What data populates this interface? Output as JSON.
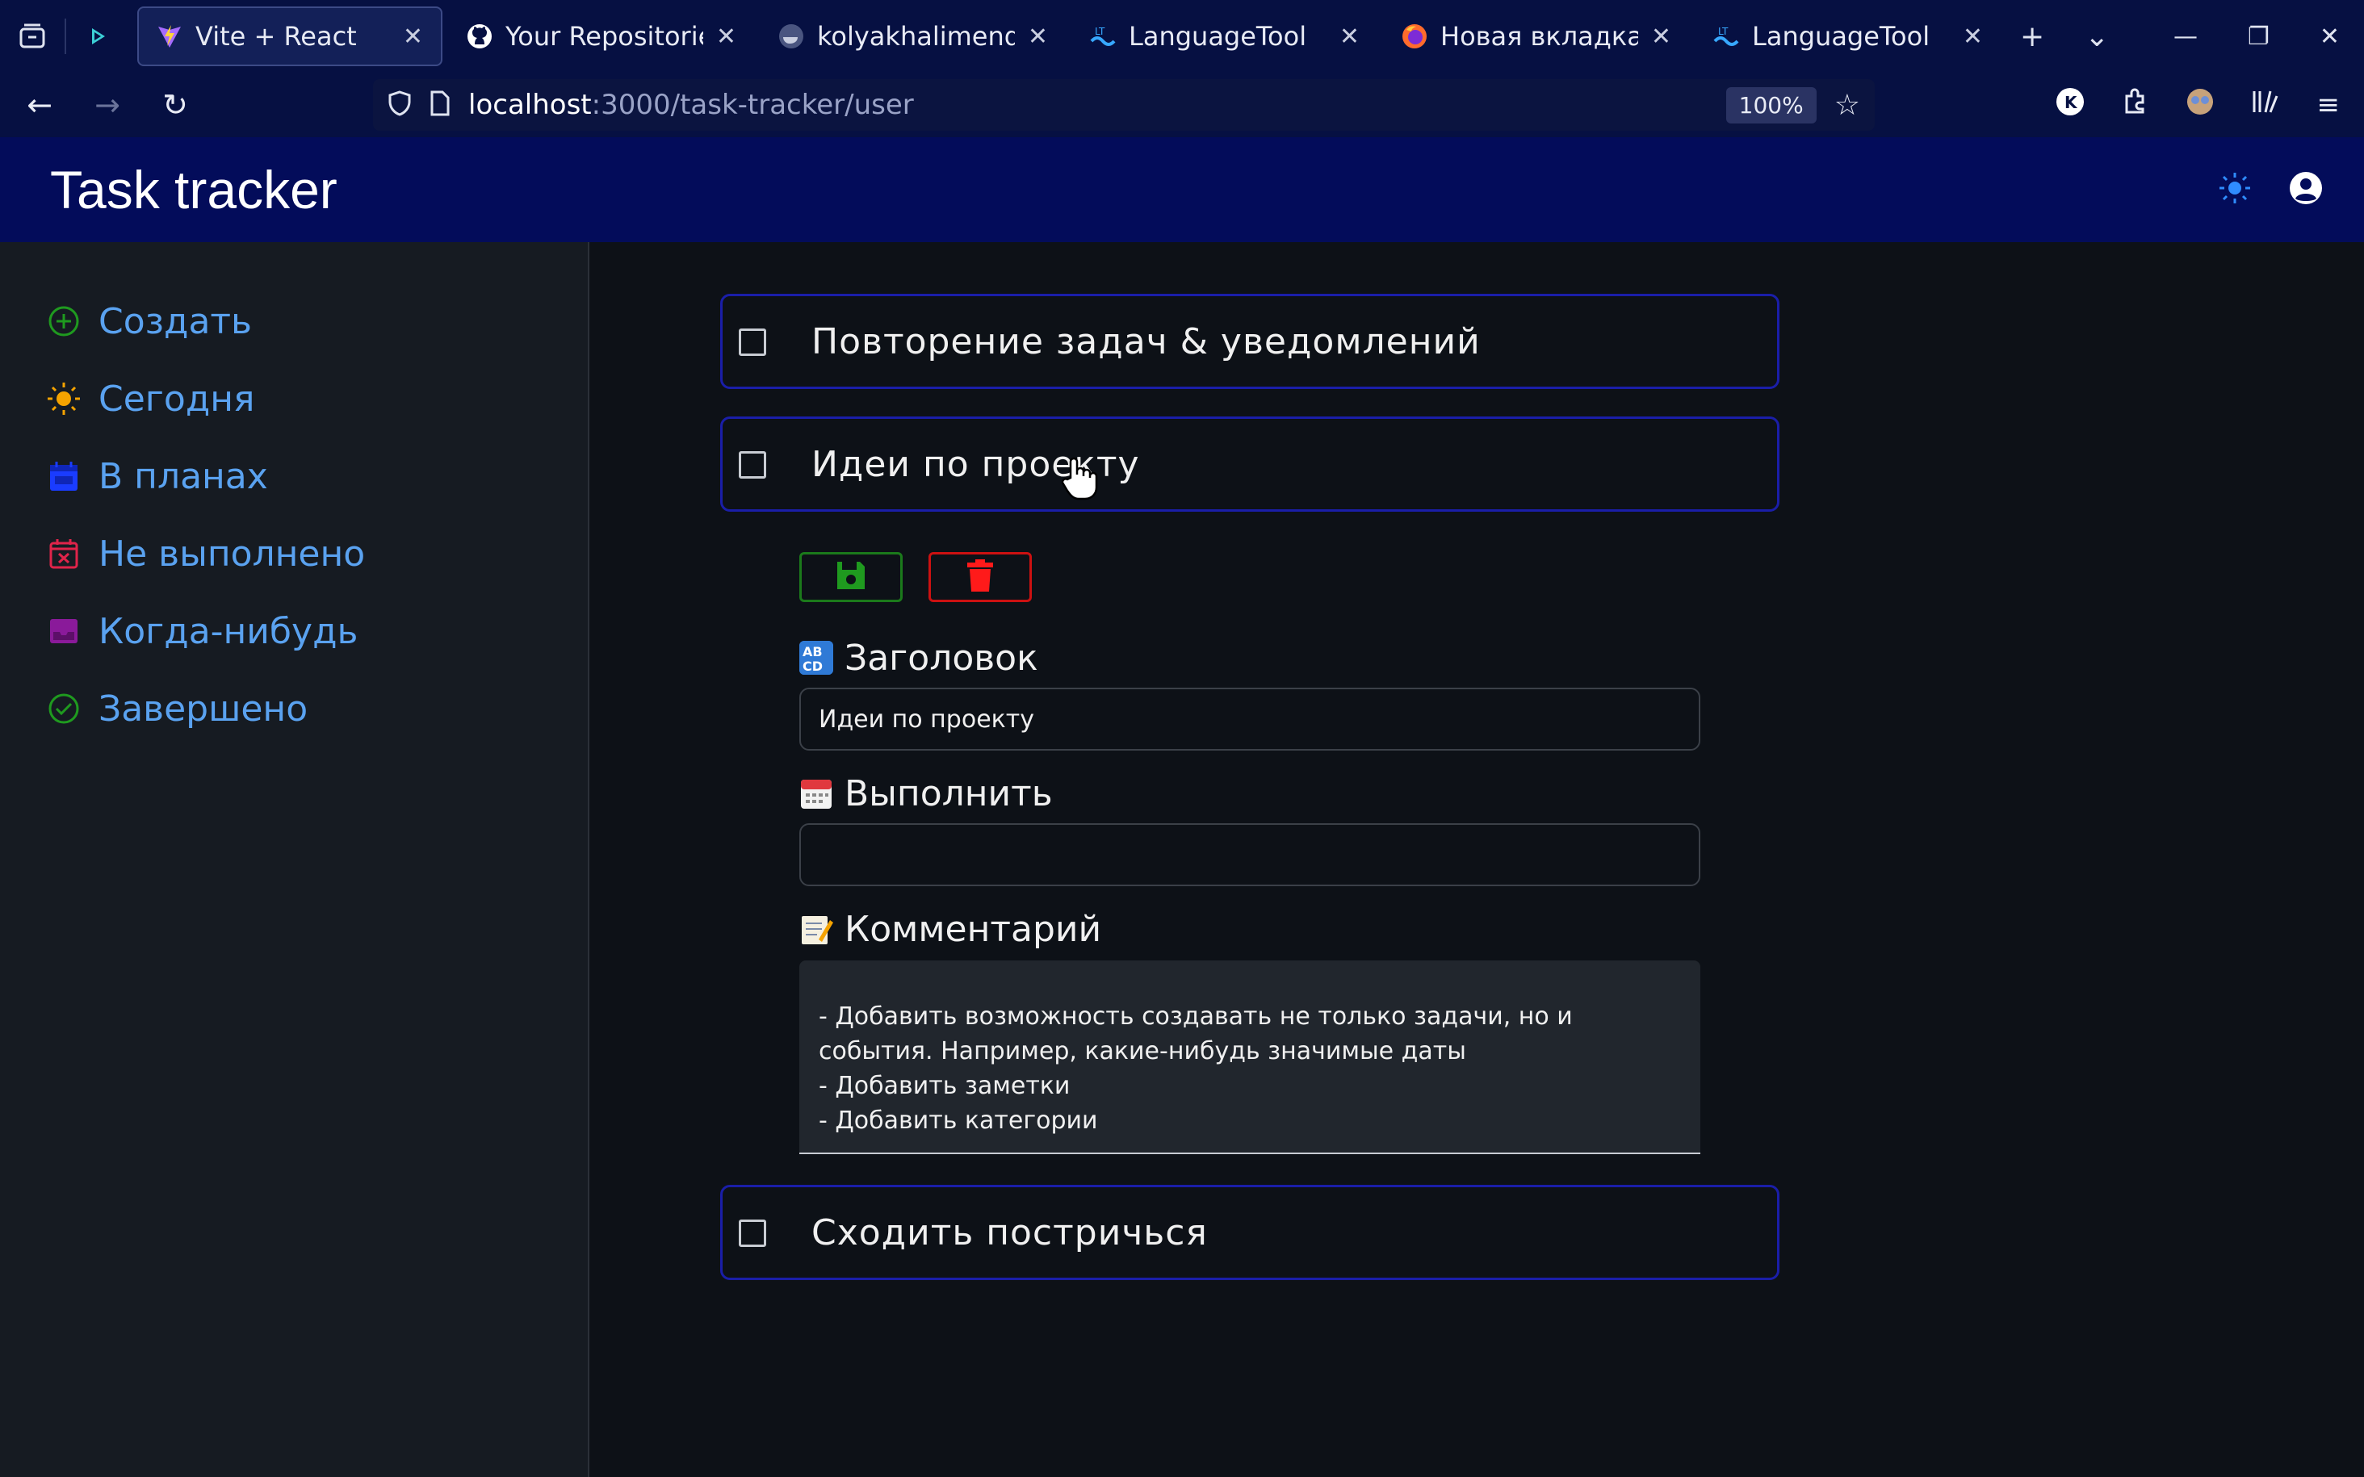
{
  "browser": {
    "tabs": [
      {
        "title": "Vite + React",
        "active": true
      },
      {
        "title": "Your Repositories",
        "active": false
      },
      {
        "title": "kolyakhalimendik",
        "active": false
      },
      {
        "title": "LanguageTool",
        "active": false
      },
      {
        "title": "Новая вкладка",
        "active": false
      },
      {
        "title": "LanguageTool",
        "active": false
      }
    ],
    "url_host": "localhost",
    "url_path": ":3000/task-tracker/user",
    "zoom": "100%"
  },
  "app": {
    "title": "Task tracker",
    "accent": "#030c5a"
  },
  "sidebar": {
    "items": [
      {
        "label": "Создать",
        "icon": "plus-circle-icon",
        "color": "#1f9a1f"
      },
      {
        "label": "Сегодня",
        "icon": "sun-icon",
        "color": "#f5a300"
      },
      {
        "label": "В планах",
        "icon": "calendar-icon",
        "color": "#1a3cff"
      },
      {
        "label": "Не выполнено",
        "icon": "calendar-x-icon",
        "color": "#e0244a"
      },
      {
        "label": "Когда-нибудь",
        "icon": "inbox-icon",
        "color": "#8a1a9a"
      },
      {
        "label": "Завершено",
        "icon": "check-circle-icon",
        "color": "#1f9a1f"
      }
    ]
  },
  "tasks": [
    {
      "title": "Повторение задач & уведомлений",
      "done": false
    },
    {
      "title": "Идеи по проекту",
      "done": false
    },
    {
      "title": "Сходить постричься",
      "done": false
    }
  ],
  "editor": {
    "title_label": "Заголовок",
    "title_value": "Идеи по проекту",
    "due_label": "Выполнить",
    "due_value": "",
    "comment_label": "Комментарий",
    "comment_value": "- Добавить возможность создавать не только задачи, но и события. Например, какие-нибудь значимые даты\n- Добавить заметки\n- Добавить категории"
  }
}
